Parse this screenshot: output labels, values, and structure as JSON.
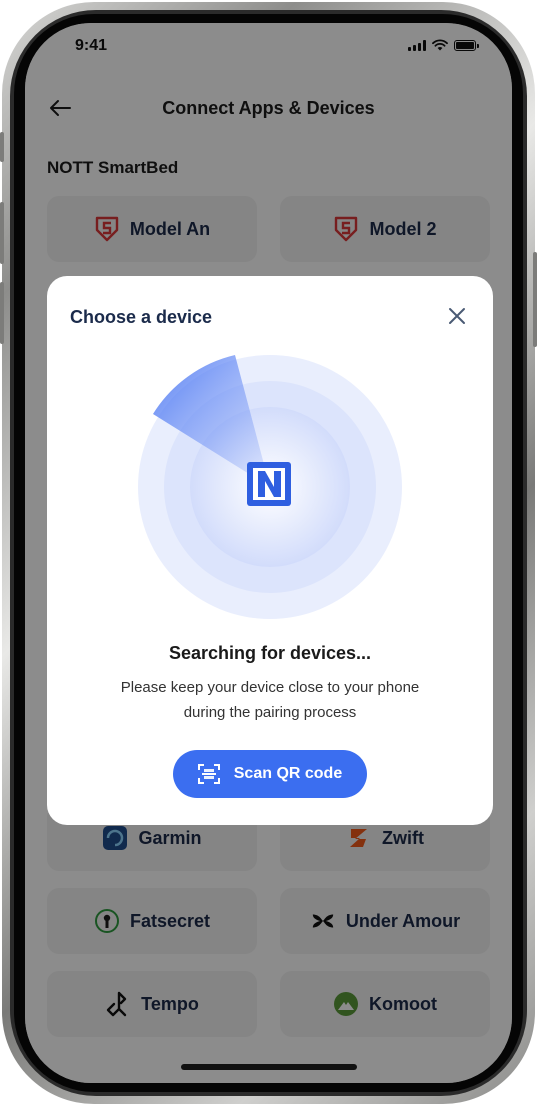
{
  "status_bar": {
    "time": "9:41",
    "icons": [
      "signal-icon",
      "wifi-icon",
      "battery-icon"
    ]
  },
  "header": {
    "back_icon": "arrow-left-icon",
    "title": "Connect Apps & Devices"
  },
  "section": {
    "title": "NOTT SmartBed"
  },
  "devices": [
    {
      "label": "Model An",
      "icon": "shield-s-icon",
      "color": "#d9373a"
    },
    {
      "label": "Model 2",
      "icon": "shield-s-icon",
      "color": "#d9373a"
    }
  ],
  "apps": [
    {
      "label": "Garmin",
      "icon": "garmin-icon"
    },
    {
      "label": "Zwift",
      "icon": "zwift-icon",
      "color": "#f05a1a"
    },
    {
      "label": "Fatsecret",
      "icon": "fatsecret-icon",
      "color": "#2e9a3f"
    },
    {
      "label": "Under Amour",
      "icon": "under-armour-icon"
    },
    {
      "label": "Tempo",
      "icon": "tempo-icon"
    },
    {
      "label": "Komoot",
      "icon": "komoot-icon",
      "color": "#5a9a3a"
    }
  ],
  "modal": {
    "title": "Choose a device",
    "close_icon": "close-icon",
    "radar_icon": "nott-logo-icon",
    "searching": "Searching for devices...",
    "hint_line1": "Please keep your device close to your phone",
    "hint_line2": "during the pairing process",
    "scan_icon": "qr-scan-icon",
    "scan_label": "Scan QR code"
  },
  "colors": {
    "accent": "#3b6ef0",
    "title_text": "#1b2b4b",
    "overlay": "rgba(0,0,0,0.45)"
  }
}
